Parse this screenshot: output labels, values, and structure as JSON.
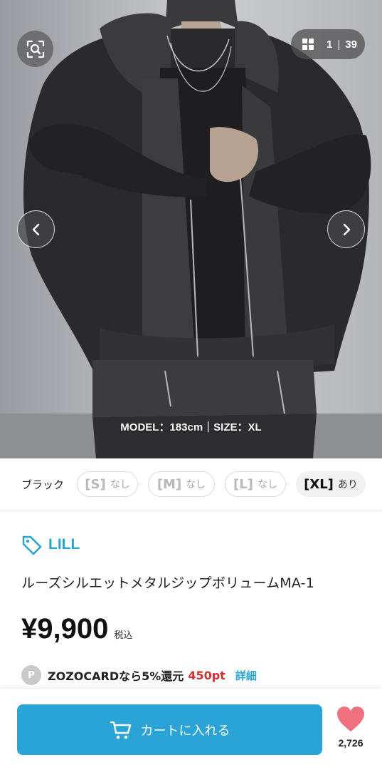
{
  "gallery": {
    "current": "1",
    "separator": "|",
    "total": "39",
    "caption": "MODEL：183cm｜SIZE：XL",
    "icons": {
      "zoom": "search-image-icon",
      "grid": "grid-icon",
      "prev": "chevron-left-icon",
      "next": "chevron-right-icon"
    }
  },
  "sizes": {
    "color_label": "ブラック",
    "options": [
      {
        "size": "[S]",
        "status": "なし",
        "available": false
      },
      {
        "size": "[M]",
        "status": "なし",
        "available": false
      },
      {
        "size": "[L]",
        "status": "なし",
        "available": false
      },
      {
        "size": "[XL]",
        "status": "あり",
        "available": true
      }
    ]
  },
  "product": {
    "brand": "LILL",
    "title": "ルーズシルエットメタルジップボリュームMA-1",
    "price": "¥9,900",
    "tax_label": "税込"
  },
  "card_offer": {
    "badge": "P",
    "text": "ZOZOCARDなら5%還元",
    "points": "450pt",
    "details_link": "詳細"
  },
  "actions": {
    "cart_label": "カートに入れる",
    "favorite_count": "2,726"
  },
  "colors": {
    "accent": "#2aa4d6",
    "points_red": "#d72e2e",
    "heart": "#f0707d"
  }
}
